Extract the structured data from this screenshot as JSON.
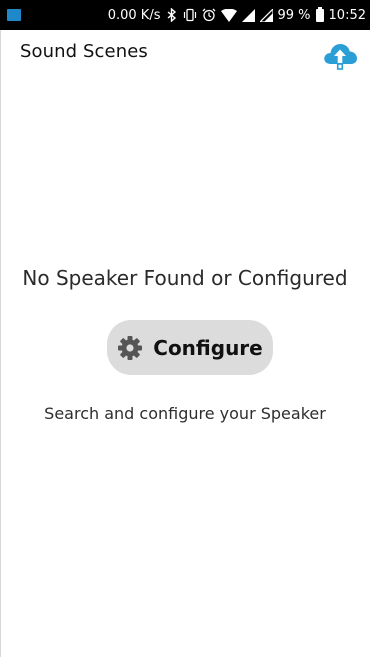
{
  "status_bar": {
    "network_speed": "0.00 K/s",
    "battery_percent": "99 %",
    "time": "10:52",
    "icons": [
      "app-notification-icon",
      "bluetooth-icon",
      "vibrate-icon",
      "alarm-icon",
      "wifi-icon",
      "signal-icon",
      "signal-icon-2",
      "battery-icon"
    ]
  },
  "header": {
    "title": "Sound Scenes",
    "upload_icon": "cloud-upload-icon",
    "accent_color": "#2a9fd6"
  },
  "main": {
    "empty_message": "No Speaker Found or Configured",
    "configure_button": {
      "label": "Configure",
      "icon": "gear-icon"
    },
    "hint": "Search and configure your Speaker"
  }
}
